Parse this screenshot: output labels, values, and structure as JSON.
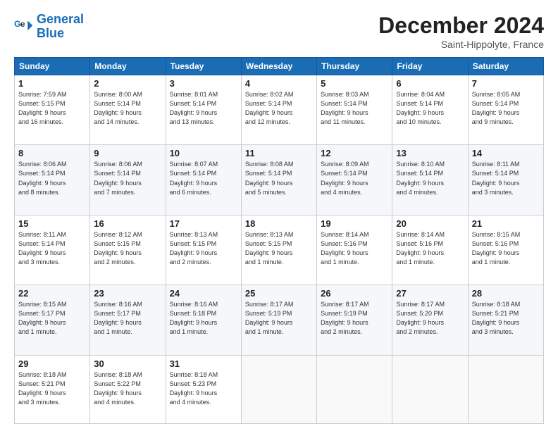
{
  "logo": {
    "line1": "General",
    "line2": "Blue"
  },
  "header": {
    "month_year": "December 2024",
    "location": "Saint-Hippolyte, France"
  },
  "days_of_week": [
    "Sunday",
    "Monday",
    "Tuesday",
    "Wednesday",
    "Thursday",
    "Friday",
    "Saturday"
  ],
  "weeks": [
    [
      {
        "day": "1",
        "info": "Sunrise: 7:59 AM\nSunset: 5:15 PM\nDaylight: 9 hours\nand 16 minutes."
      },
      {
        "day": "2",
        "info": "Sunrise: 8:00 AM\nSunset: 5:14 PM\nDaylight: 9 hours\nand 14 minutes."
      },
      {
        "day": "3",
        "info": "Sunrise: 8:01 AM\nSunset: 5:14 PM\nDaylight: 9 hours\nand 13 minutes."
      },
      {
        "day": "4",
        "info": "Sunrise: 8:02 AM\nSunset: 5:14 PM\nDaylight: 9 hours\nand 12 minutes."
      },
      {
        "day": "5",
        "info": "Sunrise: 8:03 AM\nSunset: 5:14 PM\nDaylight: 9 hours\nand 11 minutes."
      },
      {
        "day": "6",
        "info": "Sunrise: 8:04 AM\nSunset: 5:14 PM\nDaylight: 9 hours\nand 10 minutes."
      },
      {
        "day": "7",
        "info": "Sunrise: 8:05 AM\nSunset: 5:14 PM\nDaylight: 9 hours\nand 9 minutes."
      }
    ],
    [
      {
        "day": "8",
        "info": "Sunrise: 8:06 AM\nSunset: 5:14 PM\nDaylight: 9 hours\nand 8 minutes."
      },
      {
        "day": "9",
        "info": "Sunrise: 8:06 AM\nSunset: 5:14 PM\nDaylight: 9 hours\nand 7 minutes."
      },
      {
        "day": "10",
        "info": "Sunrise: 8:07 AM\nSunset: 5:14 PM\nDaylight: 9 hours\nand 6 minutes."
      },
      {
        "day": "11",
        "info": "Sunrise: 8:08 AM\nSunset: 5:14 PM\nDaylight: 9 hours\nand 5 minutes."
      },
      {
        "day": "12",
        "info": "Sunrise: 8:09 AM\nSunset: 5:14 PM\nDaylight: 9 hours\nand 4 minutes."
      },
      {
        "day": "13",
        "info": "Sunrise: 8:10 AM\nSunset: 5:14 PM\nDaylight: 9 hours\nand 4 minutes."
      },
      {
        "day": "14",
        "info": "Sunrise: 8:11 AM\nSunset: 5:14 PM\nDaylight: 9 hours\nand 3 minutes."
      }
    ],
    [
      {
        "day": "15",
        "info": "Sunrise: 8:11 AM\nSunset: 5:14 PM\nDaylight: 9 hours\nand 3 minutes."
      },
      {
        "day": "16",
        "info": "Sunrise: 8:12 AM\nSunset: 5:15 PM\nDaylight: 9 hours\nand 2 minutes."
      },
      {
        "day": "17",
        "info": "Sunrise: 8:13 AM\nSunset: 5:15 PM\nDaylight: 9 hours\nand 2 minutes."
      },
      {
        "day": "18",
        "info": "Sunrise: 8:13 AM\nSunset: 5:15 PM\nDaylight: 9 hours\nand 1 minute."
      },
      {
        "day": "19",
        "info": "Sunrise: 8:14 AM\nSunset: 5:16 PM\nDaylight: 9 hours\nand 1 minute."
      },
      {
        "day": "20",
        "info": "Sunrise: 8:14 AM\nSunset: 5:16 PM\nDaylight: 9 hours\nand 1 minute."
      },
      {
        "day": "21",
        "info": "Sunrise: 8:15 AM\nSunset: 5:16 PM\nDaylight: 9 hours\nand 1 minute."
      }
    ],
    [
      {
        "day": "22",
        "info": "Sunrise: 8:15 AM\nSunset: 5:17 PM\nDaylight: 9 hours\nand 1 minute."
      },
      {
        "day": "23",
        "info": "Sunrise: 8:16 AM\nSunset: 5:17 PM\nDaylight: 9 hours\nand 1 minute."
      },
      {
        "day": "24",
        "info": "Sunrise: 8:16 AM\nSunset: 5:18 PM\nDaylight: 9 hours\nand 1 minute."
      },
      {
        "day": "25",
        "info": "Sunrise: 8:17 AM\nSunset: 5:19 PM\nDaylight: 9 hours\nand 1 minute."
      },
      {
        "day": "26",
        "info": "Sunrise: 8:17 AM\nSunset: 5:19 PM\nDaylight: 9 hours\nand 2 minutes."
      },
      {
        "day": "27",
        "info": "Sunrise: 8:17 AM\nSunset: 5:20 PM\nDaylight: 9 hours\nand 2 minutes."
      },
      {
        "day": "28",
        "info": "Sunrise: 8:18 AM\nSunset: 5:21 PM\nDaylight: 9 hours\nand 3 minutes."
      }
    ],
    [
      {
        "day": "29",
        "info": "Sunrise: 8:18 AM\nSunset: 5:21 PM\nDaylight: 9 hours\nand 3 minutes."
      },
      {
        "day": "30",
        "info": "Sunrise: 8:18 AM\nSunset: 5:22 PM\nDaylight: 9 hours\nand 4 minutes."
      },
      {
        "day": "31",
        "info": "Sunrise: 8:18 AM\nSunset: 5:23 PM\nDaylight: 9 hours\nand 4 minutes."
      },
      {
        "day": "",
        "info": ""
      },
      {
        "day": "",
        "info": ""
      },
      {
        "day": "",
        "info": ""
      },
      {
        "day": "",
        "info": ""
      }
    ]
  ]
}
